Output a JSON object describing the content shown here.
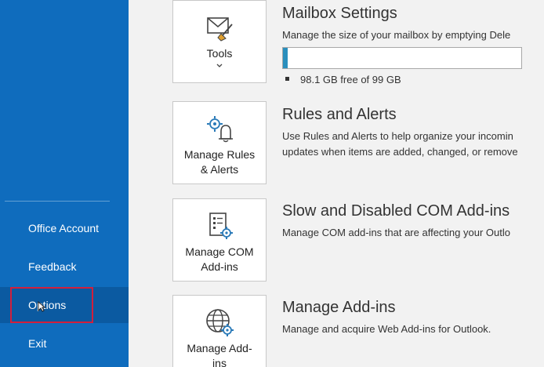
{
  "sidebar": {
    "items": [
      {
        "label": "Office Account"
      },
      {
        "label": "Feedback"
      },
      {
        "label": "Options"
      },
      {
        "label": "Exit"
      }
    ]
  },
  "sections": [
    {
      "tile_label": "Tools",
      "tile_icon": "envelope-broom-icon",
      "title": "Mailbox Settings",
      "description": "Manage the size of your mailbox by emptying Dele",
      "storage": {
        "used_fraction": 0.019,
        "text": "98.1 GB free of 99 GB"
      }
    },
    {
      "tile_label_line1": "Manage Rules",
      "tile_label_line2": "& Alerts",
      "tile_icon": "gear-bell-icon",
      "title": "Rules and Alerts",
      "desc_line1": "Use Rules and Alerts to help organize your incomin",
      "desc_line2": "updates when items are added, changed, or remove"
    },
    {
      "tile_label_line1": "Manage COM",
      "tile_label_line2": "Add-ins",
      "tile_icon": "document-gear-icon",
      "title": "Slow and Disabled COM Add-ins",
      "description": "Manage COM add-ins that are affecting your Outlo"
    },
    {
      "tile_label_line1": "Manage Add-",
      "tile_label_line2": "ins",
      "tile_icon": "globe-gear-icon",
      "title": "Manage Add-ins",
      "description": "Manage and acquire Web Add-ins for Outlook."
    }
  ],
  "colors": {
    "sidebar": "#0f6cbd",
    "highlight": "#d21f3c",
    "progress": "#2a8fbd"
  }
}
